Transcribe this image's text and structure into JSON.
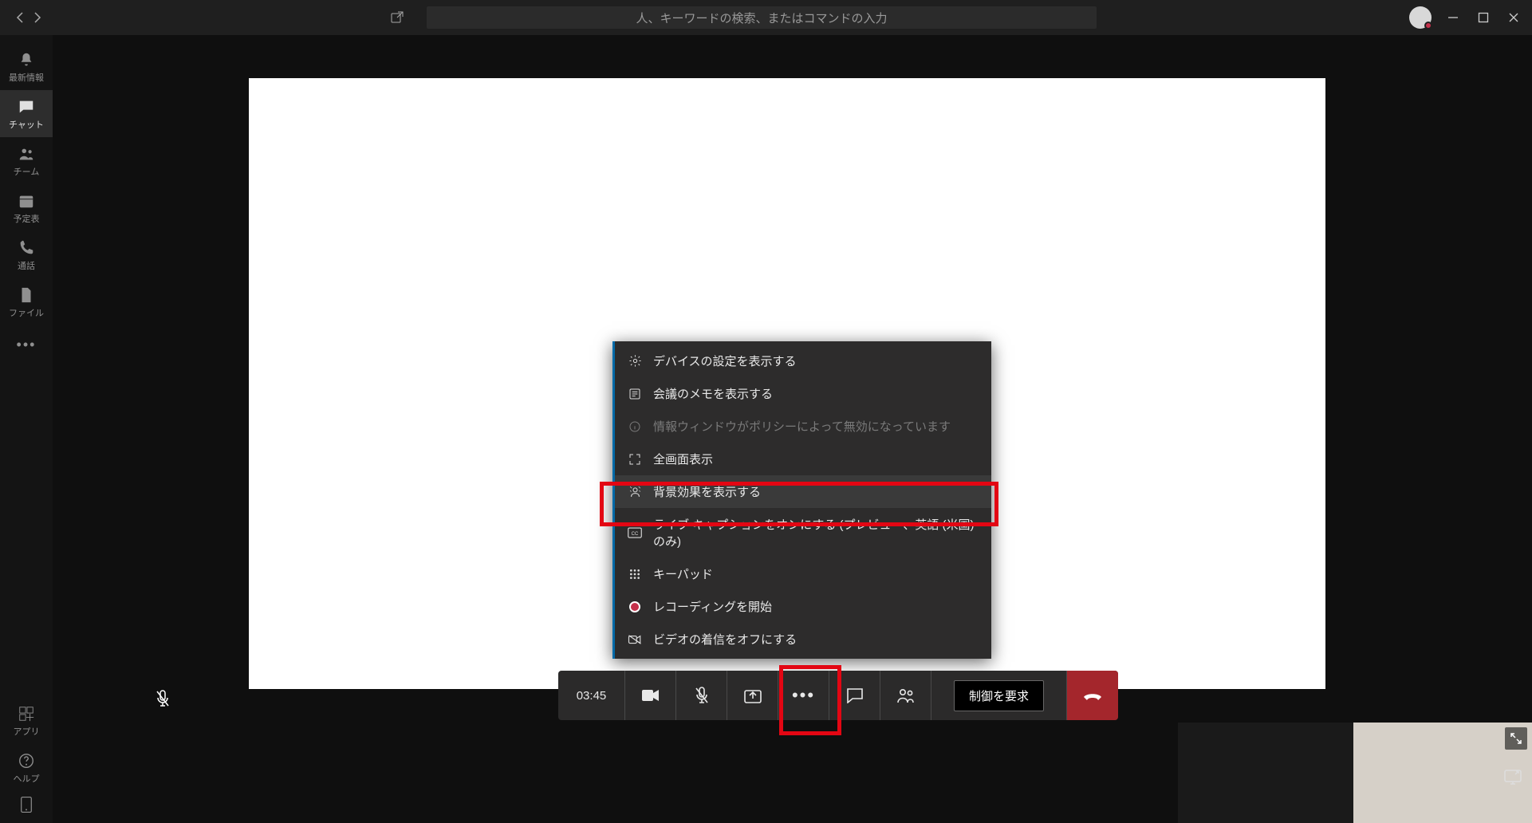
{
  "search": {
    "placeholder": "人、キーワードの検索、またはコマンドの入力"
  },
  "rail": {
    "activity": "最新情報",
    "chat": "チャット",
    "teams": "チーム",
    "calendar": "予定表",
    "calls": "通話",
    "files": "ファイル",
    "apps": "アプリ",
    "help": "ヘルプ"
  },
  "ctx": {
    "device_settings": "デバイスの設定を表示する",
    "meeting_notes": "会議のメモを表示する",
    "info_disabled": "情報ウィンドウがポリシーによって無効になっています",
    "fullscreen": "全画面表示",
    "bg_effects": "背景効果を表示する",
    "live_captions": "ライブ キャプションをオンにする (プレビュー、英語 (米国) のみ)",
    "keypad": "キーパッド",
    "start_recording": "レコーディングを開始",
    "turn_off_incoming_video": "ビデオの着信をオフにする"
  },
  "callbar": {
    "timer": "03:45",
    "request_control": "制御を要求"
  }
}
